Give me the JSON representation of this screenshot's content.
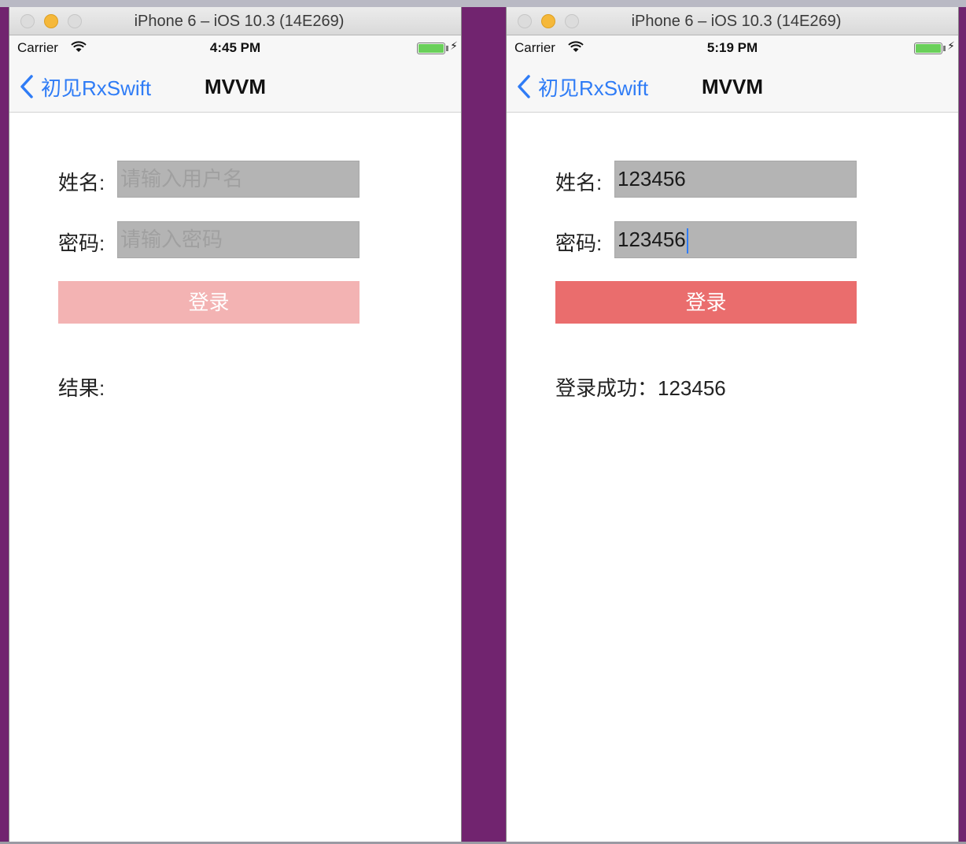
{
  "screens": [
    {
      "window_title": "iPhone 6 – iOS 10.3 (14E269)",
      "carrier": "Carrier",
      "time": "4:45 PM",
      "back_label": "初见RxSwift",
      "nav_title": "MVVM",
      "name_label": "姓名:",
      "name_value": "",
      "name_placeholder": "请输入用户名",
      "password_label": "密码:",
      "password_value": "",
      "password_placeholder": "请输入密码",
      "login_button": "登录",
      "login_enabled": false,
      "result_text": "结果:"
    },
    {
      "window_title": "iPhone 6 – iOS 10.3 (14E269)",
      "carrier": "Carrier",
      "time": "5:19 PM",
      "back_label": "初见RxSwift",
      "nav_title": "MVVM",
      "name_label": "姓名:",
      "name_value": "123456",
      "name_placeholder": "",
      "password_label": "密码:",
      "password_value": "123456",
      "password_placeholder": "",
      "login_button": "登录",
      "login_enabled": true,
      "result_text": "登录成功：123456"
    }
  ],
  "colors": {
    "background": "#71246f",
    "accent": "#2f7cf6",
    "button_enabled": "#ea6d6d",
    "button_disabled": "#f3b3b3",
    "field_background": "#b4b4b4"
  }
}
